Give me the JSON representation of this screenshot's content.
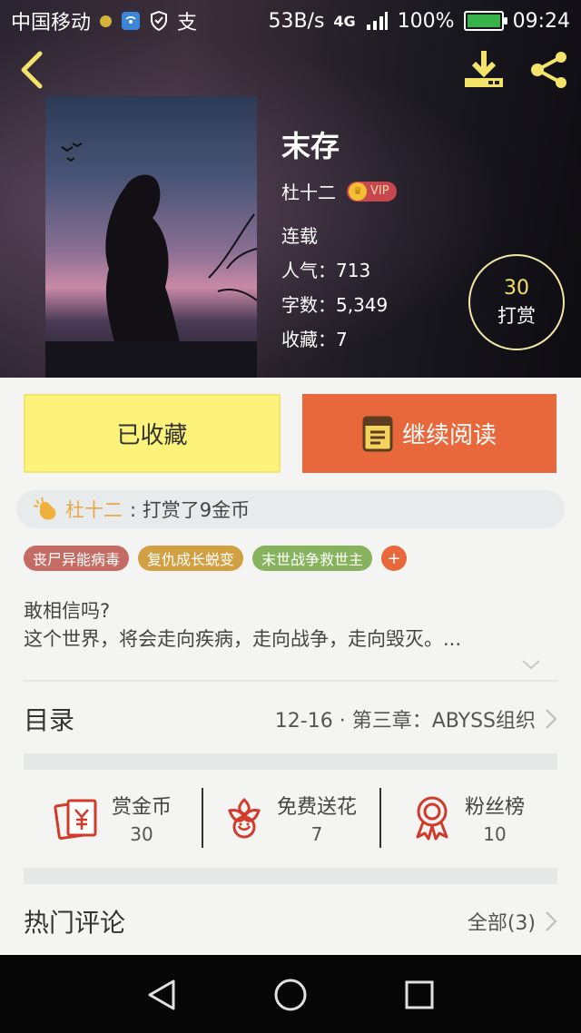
{
  "status_bar": {
    "carrier": "中国移动",
    "speed": "53B/s",
    "network": "4G",
    "battery": "100%",
    "time": "09:24",
    "notification_icon_text": "支"
  },
  "book": {
    "title": "末存",
    "author": "杜十二",
    "vip_label": "VIP",
    "status": "连载",
    "popularity": "人气：713",
    "word_count": "字数：5,349",
    "favorites": "收藏：7"
  },
  "tip": {
    "count": "30",
    "label": "打赏"
  },
  "actions": {
    "collected_label": "已收藏",
    "read_label": "继续阅读"
  },
  "tip_record": {
    "user": "杜十二",
    "text": ": 打赏了9金币"
  },
  "tags": [
    {
      "label": "丧尸异能病毒",
      "color": "#c46c63"
    },
    {
      "label": "复仇成长蜕变",
      "color": "#d2a043"
    },
    {
      "label": "末世战争救世主",
      "color": "#87b35e"
    },
    {
      "label": "+",
      "color": "#e8683c"
    }
  ],
  "intro": {
    "line1": "敢相信吗?",
    "line2": "这个世界，将会走向疾病，走向战争，走向毁灭。..."
  },
  "toc": {
    "title": "目录",
    "latest": "12-16 · 第三章：ABYSS组织"
  },
  "stats": [
    {
      "label": "赏金币",
      "value": "30",
      "icon": "red-packet-icon"
    },
    {
      "label": "免费送花",
      "value": "7",
      "icon": "flower-icon"
    },
    {
      "label": "粉丝榜",
      "value": "10",
      "icon": "medal-icon"
    }
  ],
  "comments": {
    "title": "热门评论",
    "all_label": "全部(3)"
  },
  "colors": {
    "accent_orange": "#e8683c",
    "collected_yellow": "#fdf37a",
    "tip_gold": "#f4e063",
    "icon_red": "#d23a2b"
  }
}
